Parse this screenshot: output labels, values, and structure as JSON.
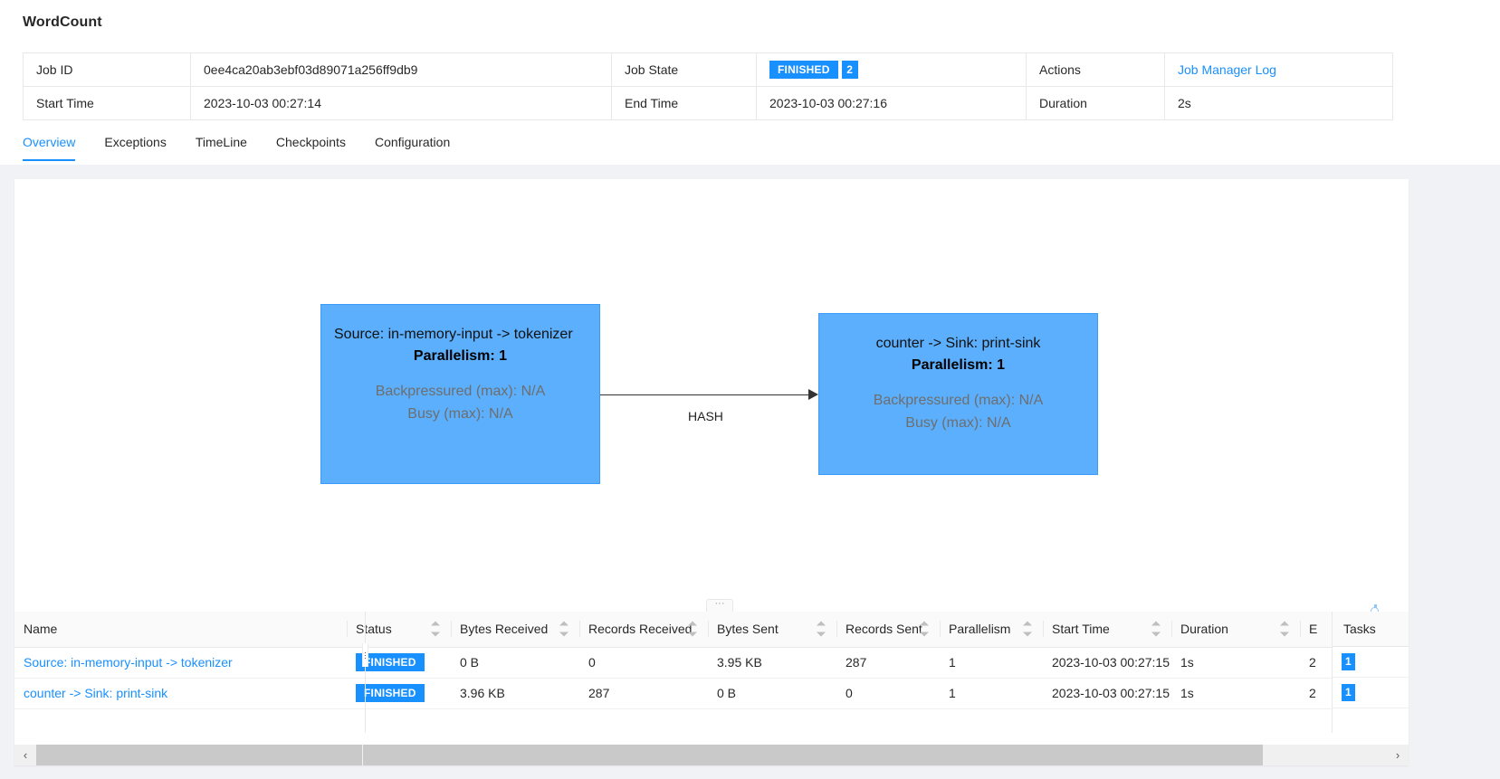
{
  "job": {
    "title": "WordCount"
  },
  "summary": {
    "job_id_label": "Job ID",
    "job_id_value": "0ee4ca20ab3ebf03d89071a256ff9db9",
    "job_state_label": "Job State",
    "job_state_value": "FINISHED",
    "job_state_count": "2",
    "actions_label": "Actions",
    "actions_link": "Job Manager Log",
    "start_time_label": "Start Time",
    "start_time_value": "2023-10-03 00:27:14",
    "end_time_label": "End Time",
    "end_time_value": "2023-10-03 00:27:16",
    "duration_label": "Duration",
    "duration_value": "2s"
  },
  "tabs": [
    {
      "label": "Overview",
      "active": true
    },
    {
      "label": "Exceptions",
      "active": false
    },
    {
      "label": "TimeLine",
      "active": false
    },
    {
      "label": "Checkpoints",
      "active": false
    },
    {
      "label": "Configuration",
      "active": false
    }
  ],
  "graph": {
    "nodes": [
      {
        "name": "Source: in-memory-input -> tokenizer",
        "parallelism": "Parallelism: 1",
        "backpressured": "Backpressured (max): N/A",
        "busy": "Busy (max): N/A"
      },
      {
        "name": "counter -> Sink: print-sink",
        "parallelism": "Parallelism: 1",
        "backpressured": "Backpressured (max): N/A",
        "busy": "Busy (max): N/A"
      }
    ],
    "edge_label": "HASH",
    "node_color": "#5BAFFC",
    "drag_handle_label": "···"
  },
  "table": {
    "columns": [
      {
        "label": "Name",
        "sortable": false
      },
      {
        "label": "Status",
        "sortable": true
      },
      {
        "label": "Bytes Received",
        "sortable": true
      },
      {
        "label": "Records Received",
        "sortable": true
      },
      {
        "label": "Bytes Sent",
        "sortable": true
      },
      {
        "label": "Records Sent",
        "sortable": true
      },
      {
        "label": "Parallelism",
        "sortable": true
      },
      {
        "label": "Start Time",
        "sortable": true
      },
      {
        "label": "Duration",
        "sortable": true
      },
      {
        "label": "E",
        "sortable": false
      }
    ],
    "tasks_column_label": "Tasks",
    "rows": [
      {
        "name": "Source: in-memory-input -> tokenizer",
        "status": "FINISHED",
        "bytes_received": "0 B",
        "records_received": "0",
        "bytes_sent": "3.95 KB",
        "records_sent": "287",
        "parallelism": "1",
        "start_time": "2023-10-03 00:27:15",
        "duration": "1s",
        "end_partial": "2",
        "tasks": "1"
      },
      {
        "name": "counter -> Sink: print-sink",
        "status": "FINISHED",
        "bytes_received": "3.96 KB",
        "records_received": "287",
        "bytes_sent": "0 B",
        "records_sent": "0",
        "parallelism": "1",
        "start_time": "2023-10-03 00:27:15",
        "duration": "1s",
        "end_partial": "2",
        "tasks": "1"
      }
    ]
  },
  "scrollbar": {
    "left_arrow": "‹",
    "right_arrow": "›"
  },
  "colors": {
    "accent": "#1890ff",
    "node": "#5BAFFC",
    "link": "#1890ff"
  }
}
